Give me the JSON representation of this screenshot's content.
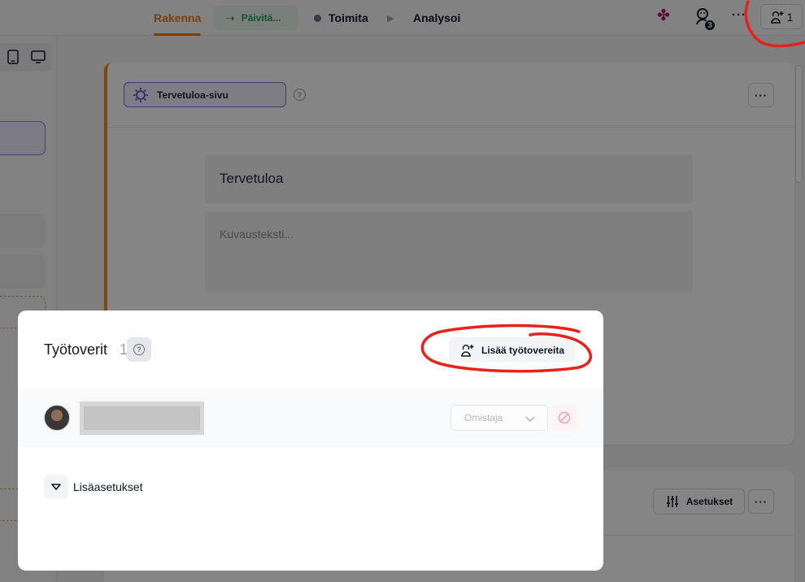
{
  "topbar": {
    "tabs": {
      "build": "Rakenna",
      "update": "Päivitä...",
      "deliver": "Toimita",
      "analyze": "Analysoi"
    },
    "user_badge_count": "3",
    "more": "···",
    "collaborators_count": "1"
  },
  "page_card": {
    "chip_label": "Tervetuloa-sivu",
    "help": "?",
    "more": "···",
    "title_value": "Tervetuloa",
    "description_placeholder": "Kuvausteksti..."
  },
  "lower_card": {
    "settings_label": "Asetukset",
    "more": "···"
  },
  "modal": {
    "title": "Työtoverit",
    "count": "1",
    "help": "?",
    "add_button": "Lisää työtovereita",
    "member": {
      "role_selected": "Omistaja"
    },
    "more_settings": "Lisäasetukset"
  },
  "colors": {
    "accent_orange": "#ea7a1a",
    "update_green": "#2a9d5c",
    "chip_purple": "#7c6fd4",
    "brand_magenta": "#b0126e",
    "annotation_red": "#e8211b"
  }
}
